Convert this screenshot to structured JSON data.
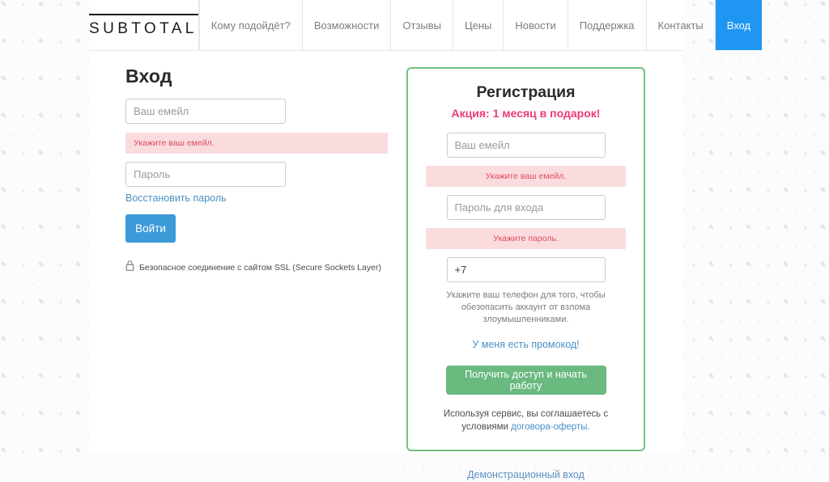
{
  "brand": {
    "name": "SUBTOTAL"
  },
  "nav": {
    "items": [
      {
        "label": "Кому подойдёт?",
        "active": false
      },
      {
        "label": "Возможности",
        "active": false
      },
      {
        "label": "Отзывы",
        "active": false
      },
      {
        "label": "Цены",
        "active": false
      },
      {
        "label": "Новости",
        "active": false
      },
      {
        "label": "Поддержка",
        "active": false
      },
      {
        "label": "Контакты",
        "active": false
      },
      {
        "label": "Вход",
        "active": true
      }
    ],
    "active_color": "#1f96f2"
  },
  "login": {
    "title": "Вход",
    "email_placeholder": "Ваш емейл",
    "email_value": "",
    "email_error": "Укажите ваш емейл.",
    "password_placeholder": "Пароль",
    "password_value": "",
    "recover_link": "Восстановить пароль",
    "submit_label": "Войти",
    "ssl_icon": "lock-icon",
    "ssl_text": "Безопасное соединение с сайтом SSL (Secure Sockets Layer)",
    "button_color": "#3d9ad8",
    "error_bg": "#fadcdf",
    "error_color": "#e04a5c"
  },
  "registration": {
    "title": "Регистрация",
    "promo": "Акция: 1 месяц в подарок!",
    "promo_color": "#ec3b72",
    "email_placeholder": "Ваш емейл",
    "email_value": "",
    "email_error": "Укажите ваш емейл.",
    "password_placeholder": "Пароль для входа",
    "password_value": "",
    "password_error": "Укажите пароль.",
    "phone_placeholder": "+7",
    "phone_value": "+7",
    "phone_hint": "Укажите ваш телефон для того, чтобы обезопасить аккаунт от взлома злоумышленниками.",
    "promocode_link": "У меня есть промокод!",
    "submit_label": "Получить доступ и начать работу",
    "terms_prefix": "Используя сервис, вы соглашаетесь с условиями",
    "terms_link": "договора-оферты.",
    "border_color": "#72c083",
    "button_color": "#6ab97f"
  },
  "footer": {
    "demo_link": "Демонстрационный вход"
  }
}
